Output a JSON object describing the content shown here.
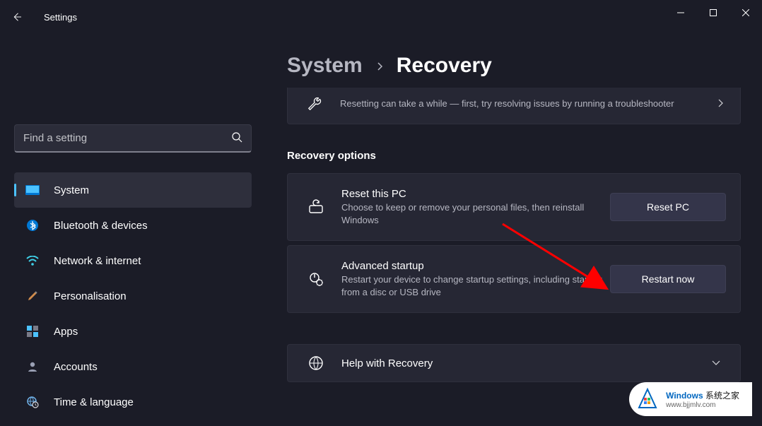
{
  "titlebar": {
    "title": "Settings"
  },
  "search": {
    "placeholder": "Find a setting"
  },
  "nav": {
    "items": [
      {
        "label": "System"
      },
      {
        "label": "Bluetooth & devices"
      },
      {
        "label": "Network & internet"
      },
      {
        "label": "Personalisation"
      },
      {
        "label": "Apps"
      },
      {
        "label": "Accounts"
      },
      {
        "label": "Time & language"
      }
    ]
  },
  "breadcrumb": {
    "parent": "System",
    "current": "Recovery"
  },
  "troubleshoot": {
    "desc": "Resetting can take a while — first, try resolving issues by running a troubleshooter"
  },
  "section_title": "Recovery options",
  "reset": {
    "title": "Reset this PC",
    "desc": "Choose to keep or remove your personal files, then reinstall Windows",
    "button": "Reset PC"
  },
  "advanced": {
    "title": "Advanced startup",
    "desc": "Restart your device to change startup settings, including starting from a disc or USB drive",
    "button": "Restart now"
  },
  "help": {
    "title": "Help with Recovery"
  },
  "watermark": {
    "brand": "Windows",
    "suffix": " 系统之家",
    "url": "www.bjjmlv.com"
  }
}
